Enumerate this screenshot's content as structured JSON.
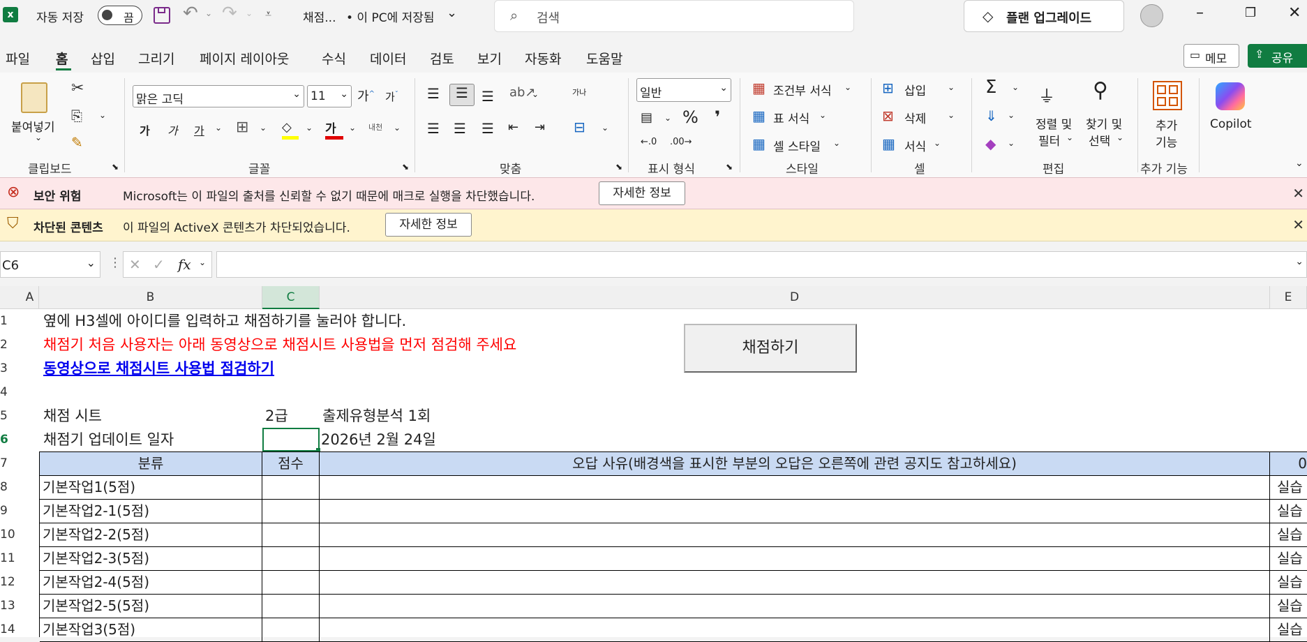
{
  "titlebar": {
    "autosave_label": "자동 저장",
    "autosave_state": "끔",
    "filename": "채점...",
    "save_state": "• 이 PC에 저장됨",
    "search_placeholder": "검색",
    "upgrade_label": "플랜 업그레이드"
  },
  "menu": {
    "tabs": [
      "파일",
      "홈",
      "삽입",
      "그리기",
      "페이지 레이아웃",
      "수식",
      "데이터",
      "검토",
      "보기",
      "자동화",
      "도움말"
    ],
    "active_tab": "홈",
    "memo_label": "메모",
    "share_label": "공유"
  },
  "ribbon": {
    "clipboard": {
      "paste_label": "붙여넣기",
      "group_label": "클립보드"
    },
    "font": {
      "font_name": "맑은 고딕",
      "font_size": "11",
      "group_label": "글꼴",
      "bold": "가",
      "italic": "가",
      "underline": "가",
      "font_color": "가",
      "phonetic": "내천"
    },
    "alignment": {
      "group_label": "맞춤",
      "wrap": "가나"
    },
    "number": {
      "format": "일반",
      "group_label": "표시 형식"
    },
    "styles": {
      "conditional": "조건부 서식",
      "table": "표 서식",
      "cell_style": "셀 스타일",
      "group_label": "스타일"
    },
    "cells": {
      "insert": "삽입",
      "delete": "삭제",
      "format": "서식",
      "group_label": "셀"
    },
    "editing": {
      "sort_line1": "정렬 및",
      "sort_line2": "필터",
      "find_line1": "찾기 및",
      "find_line2": "선택",
      "group_label": "편집"
    },
    "addins": {
      "line1": "추가",
      "line2": "기능",
      "group_label": "추가 기능"
    },
    "copilot": {
      "label": "Copilot"
    }
  },
  "security_bar": {
    "title": "보안 위험",
    "message": "Microsoft는 이 파일의 출처를 신뢰할 수 없기 때문에 매크로 실행을 차단했습니다.",
    "button": "자세한 정보"
  },
  "activex_bar": {
    "title": "차단된 콘텐츠",
    "message": "이 파일의 ActiveX 콘텐츠가 차단되었습니다.",
    "button": "자세한 정보"
  },
  "formula_bar": {
    "name_box": "C6",
    "fx": "fx",
    "value": ""
  },
  "sheet": {
    "columns": [
      "A",
      "B",
      "C",
      "D",
      "E"
    ],
    "rows": [
      "1",
      "2",
      "3",
      "4",
      "5",
      "6",
      "7",
      "8",
      "9",
      "10",
      "11",
      "12",
      "13",
      "14"
    ],
    "r1": "옆에 H3셀에 아이디를 입력하고 채점하기를 눌러야 합니다.",
    "r2": "채점기 처음 사용자는 아래 동영상으로 채점시트 사용법을 먼저 점검해 주세요",
    "r3_link": "동영상으로 채점시트 사용법 점검하기",
    "grade_button": "채점하기",
    "r5_b": "채점 시트",
    "r5_c": "2급",
    "r5_d": "출제유형분석 1회",
    "r6_b": "채점기 업데이트 일자",
    "r6_d": "2026년 2월 24일",
    "table_header": {
      "b": "분류",
      "c": "점수",
      "d": "오답 사유(배경색을 표시한 부분의 오답은 오른쪽에 관련 공지도 참고하세요)",
      "e": "0"
    },
    "table_rows": [
      {
        "b": "기본작업1(5점)",
        "e": "실습"
      },
      {
        "b": "기본작업2-1(5점)",
        "e": "실습"
      },
      {
        "b": "기본작업2-2(5점)",
        "e": "실습"
      },
      {
        "b": "기본작업2-3(5점)",
        "e": "실습"
      },
      {
        "b": "기본작업2-4(5점)",
        "e": "실습"
      },
      {
        "b": "기본작업2-5(5점)",
        "e": "실습"
      },
      {
        "b": "기본작업3(5점)",
        "e": "실습"
      }
    ],
    "red_color": "#ff0000",
    "link_color": "#0000ee",
    "header_fill": "#c9daf3"
  }
}
